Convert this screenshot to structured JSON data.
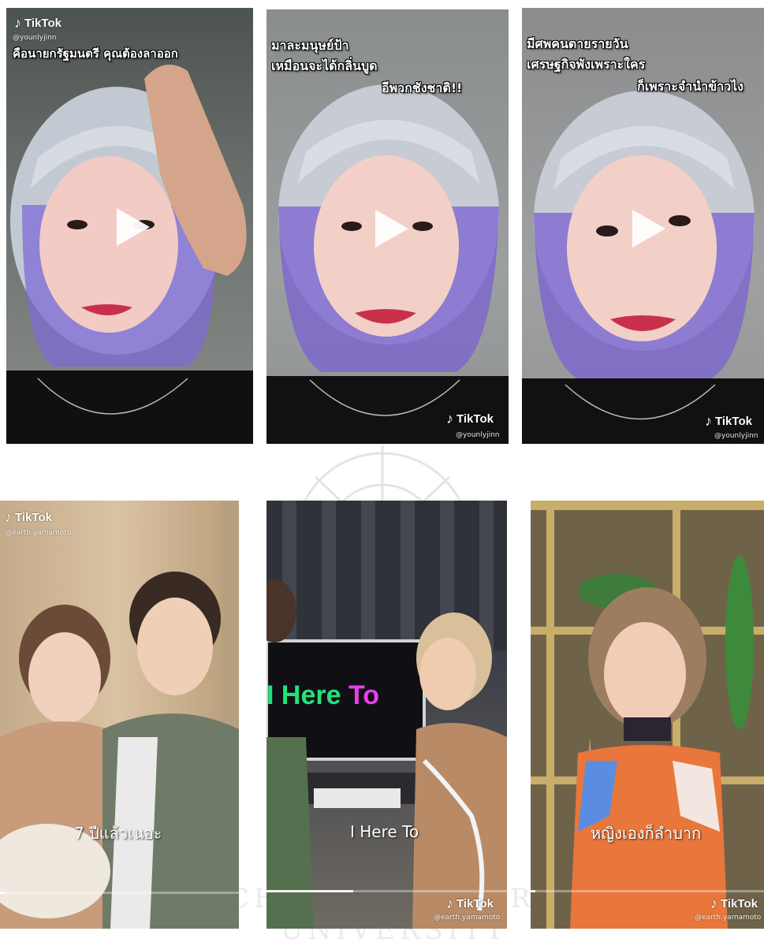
{
  "watermark": {
    "text": "CHULALONGKORN UNIVERSITY"
  },
  "brand": {
    "name": "TikTok"
  },
  "videos": [
    {
      "handle": "@younlyjinn",
      "caption_lines": [
        "คือนายกรัฐมนตรี คุณต้องลาออก"
      ],
      "subtitle": ""
    },
    {
      "handle": "@younlyjinn",
      "caption_lines": [
        "มาละมนุษย์ป้า",
        "เหมือนจะได้กลิ่นบูด",
        "อีพวกชังชาติ!!"
      ],
      "subtitle": ""
    },
    {
      "handle": "@younlyjinn",
      "caption_lines": [
        "มีศพคนตายรายวัน",
        "เศรษฐกิจพังเพราะใคร",
        "ก็เพราะจำนำข้าวไง"
      ],
      "subtitle": ""
    },
    {
      "handle": "@earth.yamamoto",
      "caption_lines": [],
      "subtitle": "7 ปีแล้วเนอะ",
      "progress": 0.02
    },
    {
      "handle": "@earth.yamamoto",
      "caption_lines": [],
      "subtitle": "I Here To",
      "screen_text": {
        "word1": "I Here",
        "word2": "To",
        "color1": "#22e37a",
        "color2": "#e93ef0"
      },
      "progress": 0.36
    },
    {
      "handle": "@earth.yamamoto",
      "caption_lines": [],
      "subtitle": "หญิงเองก็ลำบาก",
      "progress": 0.02
    }
  ]
}
